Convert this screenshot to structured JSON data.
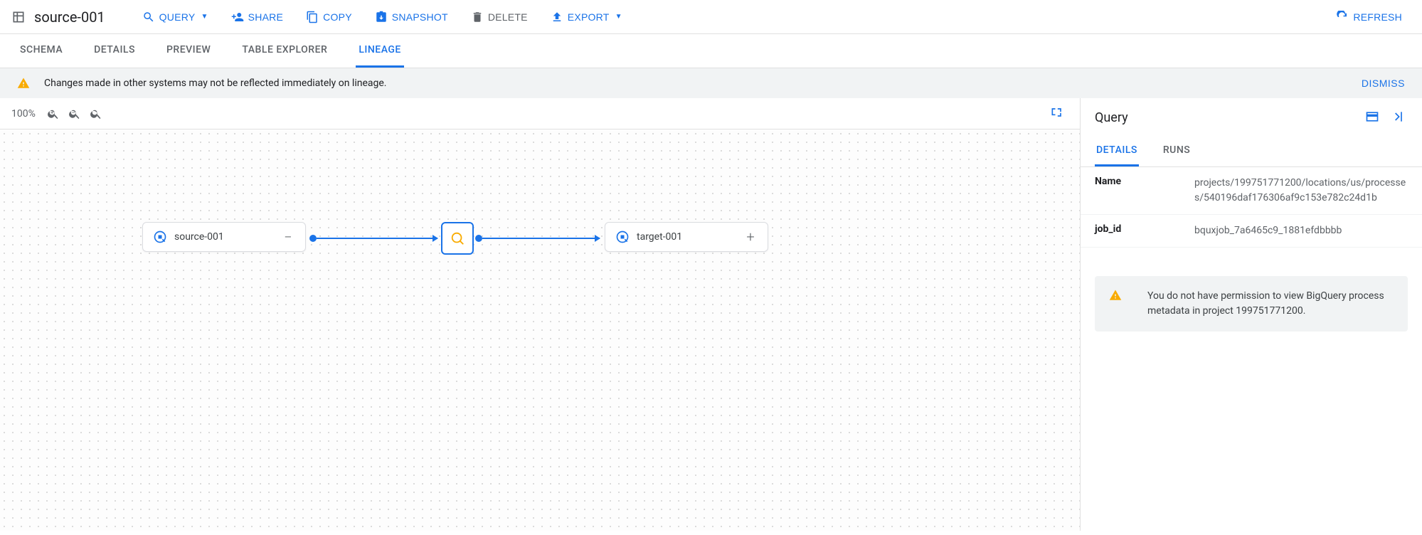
{
  "header": {
    "title": "source-001",
    "toolbar": {
      "query": "QUERY",
      "share": "SHARE",
      "copy": "COPY",
      "snapshot": "SNAPSHOT",
      "delete": "DELETE",
      "export": "EXPORT",
      "refresh": "REFRESH"
    }
  },
  "tabs": {
    "schema": "SCHEMA",
    "details": "DETAILS",
    "preview": "PREVIEW",
    "table_explorer": "TABLE EXPLORER",
    "lineage": "LINEAGE"
  },
  "banner": {
    "message": "Changes made in other systems may not be reflected immediately on lineage.",
    "dismiss": "DISMISS"
  },
  "zoom": {
    "level": "100%"
  },
  "lineage": {
    "source": {
      "label": "source-001",
      "toggle": "−"
    },
    "target": {
      "label": "target-001",
      "toggle": "+"
    }
  },
  "sidebar": {
    "title": "Query",
    "tabs": {
      "details": "DETAILS",
      "runs": "RUNS"
    },
    "rows": {
      "name": {
        "k": "Name",
        "v": "projects/199751771200/locations/us/processes/540196daf176306af9c153e782c24d1b"
      },
      "job_id": {
        "k": "job_id",
        "v": "bquxjob_7a6465c9_1881efdbbbb"
      }
    },
    "permission_warning": "You do not have permission to view BigQuery process metadata in project 199751771200."
  }
}
